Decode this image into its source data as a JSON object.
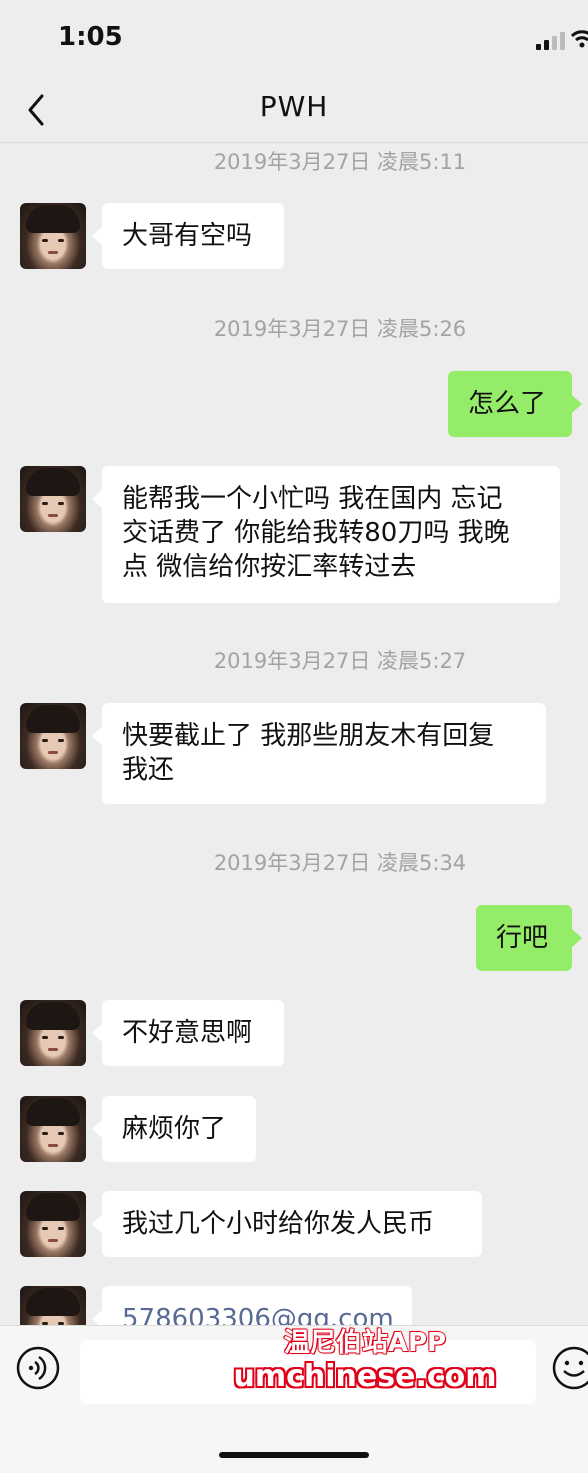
{
  "status_bar": {
    "time": "1:05"
  },
  "header": {
    "title": "PWH"
  },
  "messages": {
    "ts1": "2019年3月27日 凌晨5:11",
    "m1": "大哥有空吗",
    "ts2": "2019年3月27日 凌晨5:26",
    "m2": "怎么了",
    "m3_line1": "能帮我一个小忙吗 我在国内 忘记",
    "m3_line2": "交话费了 你能给我转80刀吗 我晚",
    "m3_line3": "点 微信给你按汇率转过去",
    "ts3": "2019年3月27日 凌晨5:27",
    "m4_line1": "快要截止了 我那些朋友木有回复",
    "m4_line2": "我还",
    "ts4": "2019年3月27日 凌晨5:34",
    "m5": "行吧",
    "m6": "不好意思啊",
    "m7": "麻烦你了",
    "m8": "我过几个小时给你发人民币",
    "m9": "578603306@qq.com"
  },
  "watermark": {
    "line1": "温尼伯站APP",
    "line2": "umchinese.com"
  },
  "icons": [
    "back-icon",
    "signal-icon",
    "wifi-icon",
    "voice-icon",
    "emoji-icon"
  ],
  "colors": {
    "sent_bubble": "#95ec69",
    "received_bubble": "#ffffff",
    "background": "#ededed",
    "email_link": "#576b95",
    "watermark_red": "#e0001a"
  }
}
